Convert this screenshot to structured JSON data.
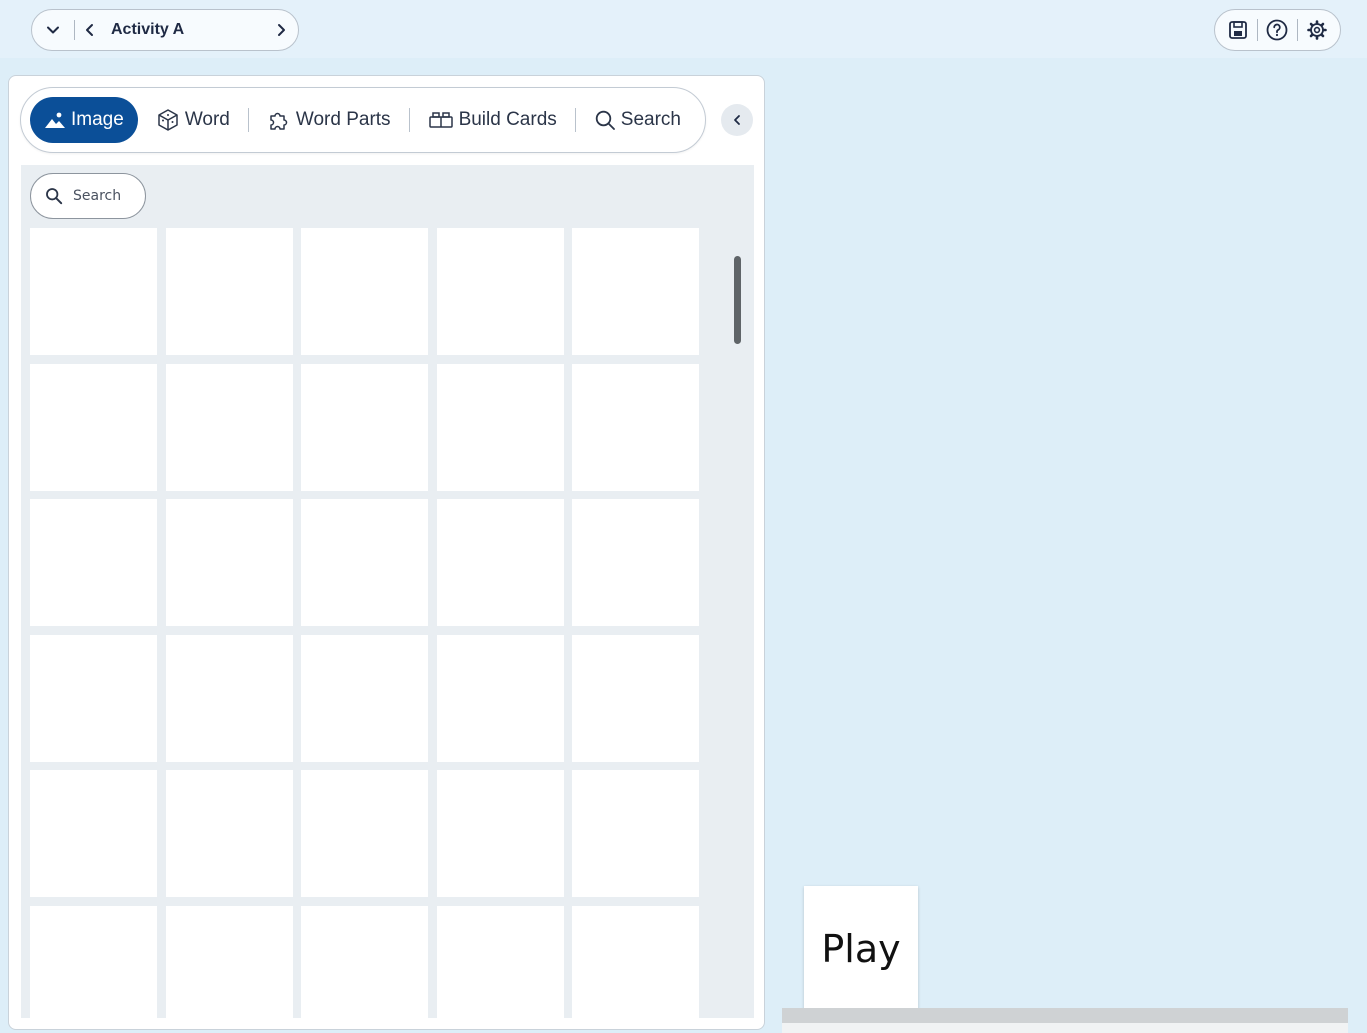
{
  "header": {
    "activity_title": "Activity A",
    "icons": {
      "menu": "chevron-down-icon",
      "previous": "chevron-left-icon",
      "next": "chevron-right-icon",
      "save": "save-icon",
      "help": "help-icon",
      "settings": "gear-icon"
    }
  },
  "panel": {
    "tabs": [
      {
        "label": "Image",
        "icon": "image-icon",
        "active": true
      },
      {
        "label": "Word",
        "icon": "cube-icon",
        "active": false
      },
      {
        "label": "Word Parts",
        "icon": "puzzle-icon",
        "active": false
      },
      {
        "label": "Build Cards",
        "icon": "blocks-icon",
        "active": false
      },
      {
        "label": "Search",
        "icon": "search-icon",
        "active": false
      }
    ],
    "search": {
      "placeholder": "Search"
    },
    "tile_count": 30
  },
  "board": {
    "cards": [
      {
        "label": "Play"
      }
    ]
  },
  "colors": {
    "accent": "#0b4f98",
    "background": "#ddeef8",
    "grid_background": "#e9eef2"
  }
}
